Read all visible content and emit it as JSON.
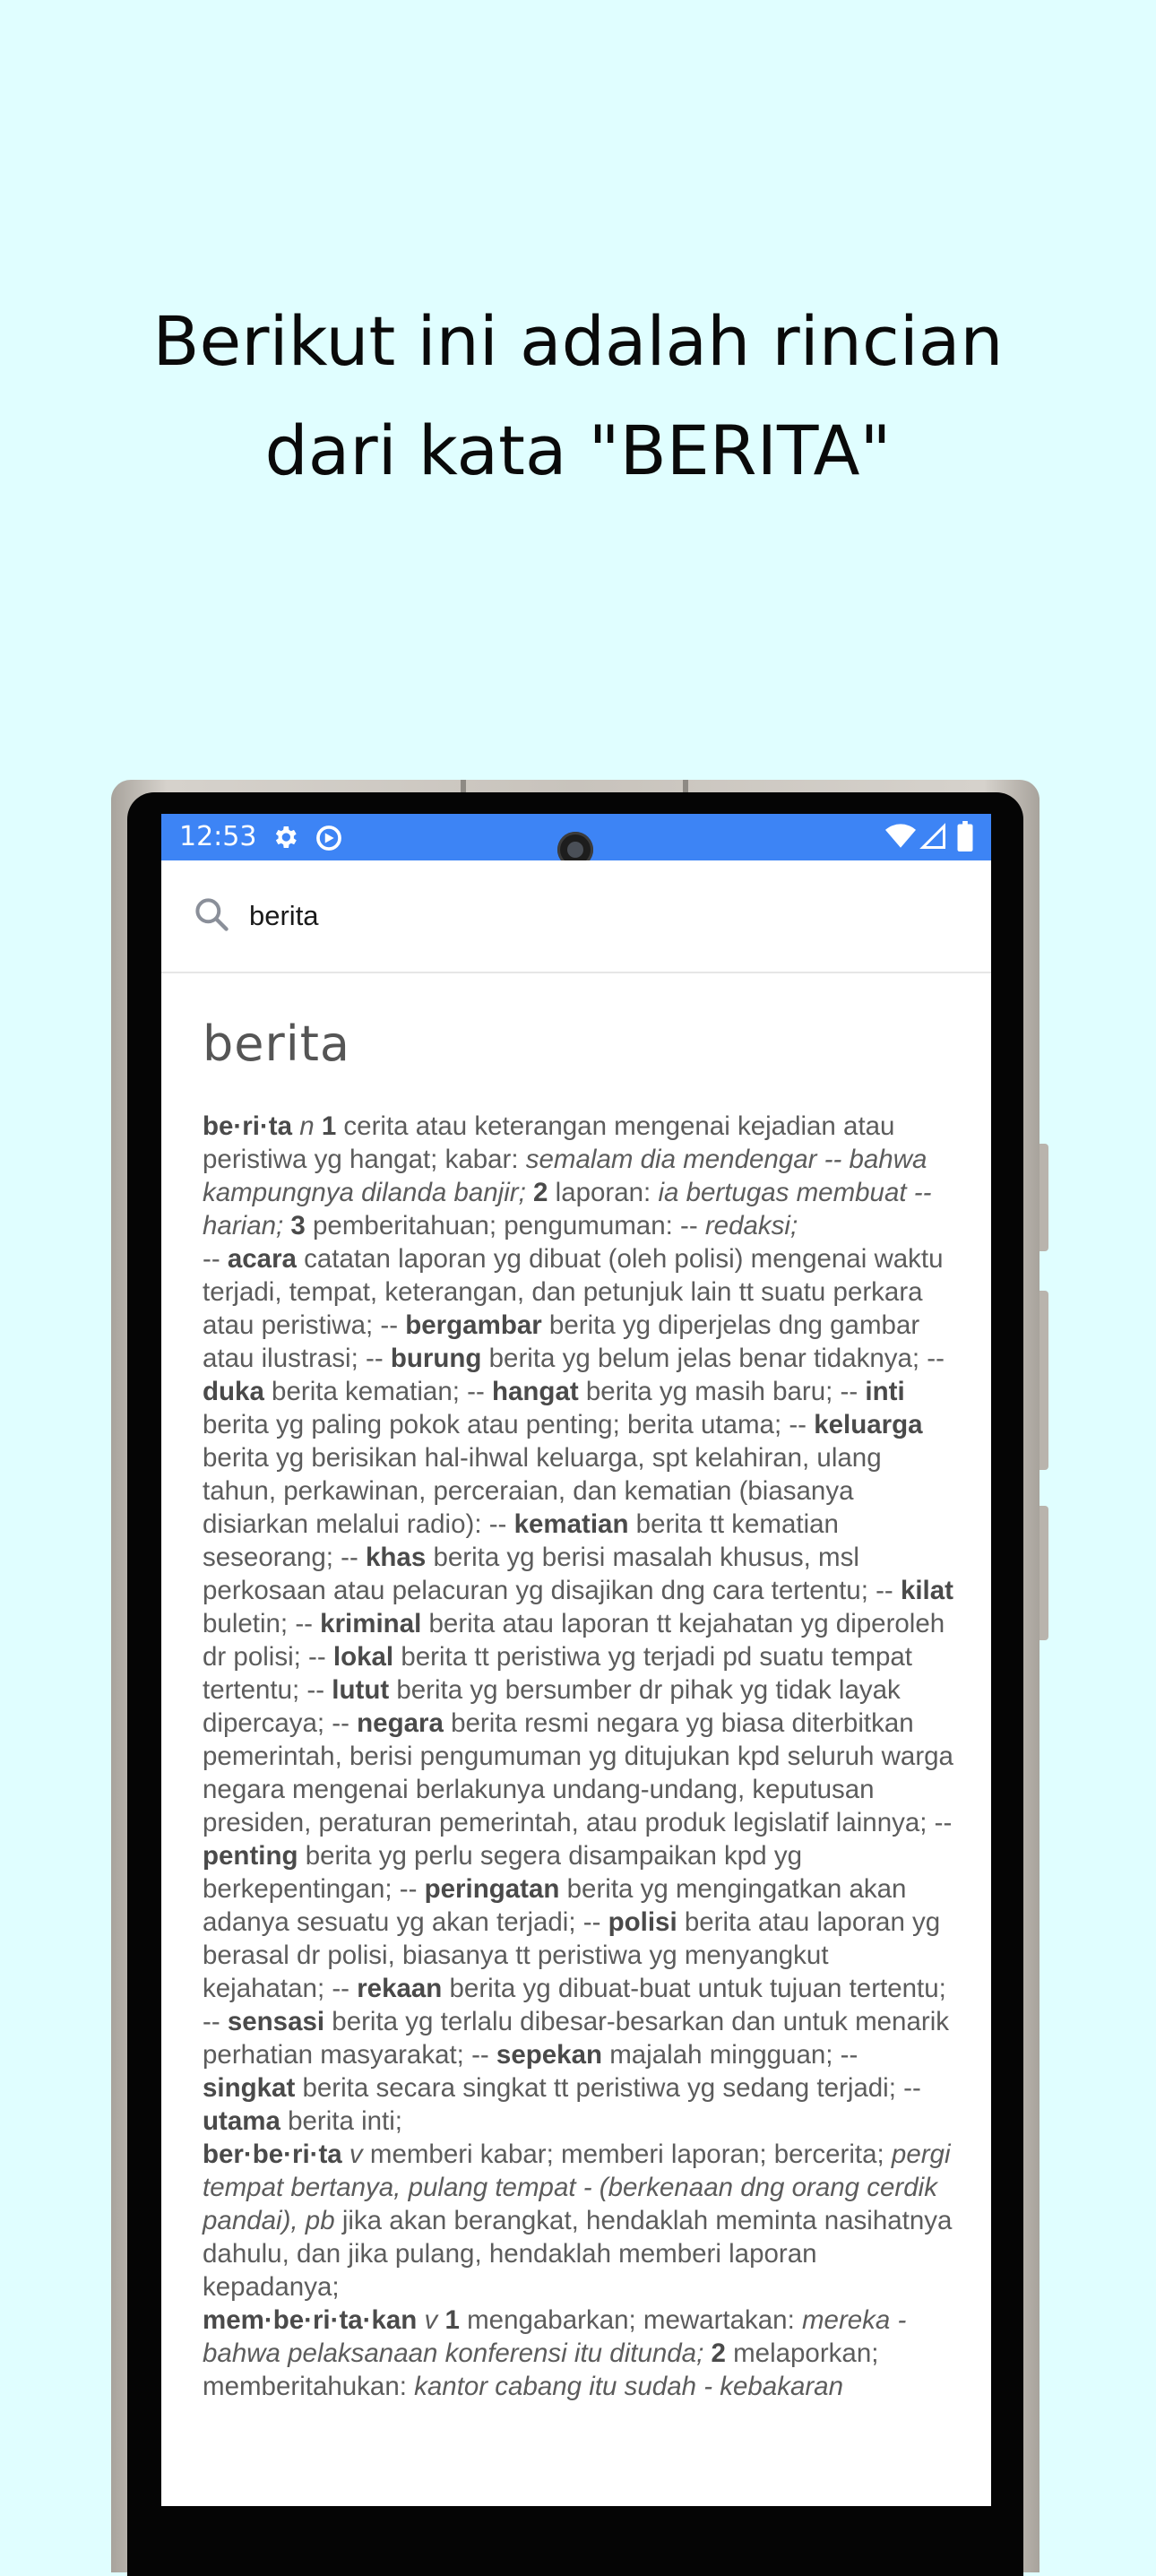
{
  "headline": {
    "line1": "Berikut ini adalah rincian",
    "line2": "dari kata \"BERITA\""
  },
  "status_bar": {
    "time": "12:53",
    "icons": [
      "gear-icon",
      "data-saver-icon",
      "wifi-icon",
      "cell-signal-icon",
      "battery-icon"
    ],
    "color": "#3d84f5"
  },
  "search": {
    "value": "berita",
    "icon": "search-icon"
  },
  "entry": {
    "word": "berita",
    "paragraphs": [
      [
        {
          "t": "be·ri·ta",
          "s": "b"
        },
        {
          "t": " "
        },
        {
          "t": "n",
          "s": "i"
        },
        {
          "t": " "
        },
        {
          "t": "1",
          "s": "b"
        },
        {
          "t": " cerita atau keterangan mengenai kejadian atau peristiwa yg hangat; kabar: "
        },
        {
          "t": "semalam dia mendengar -- bahwa kampungnya dilanda banjir;",
          "s": "i"
        },
        {
          "t": " "
        },
        {
          "t": "2",
          "s": "b"
        },
        {
          "t": " laporan: "
        },
        {
          "t": "ia bertugas membuat -- harian;",
          "s": "i"
        },
        {
          "t": " "
        },
        {
          "t": "3",
          "s": "b"
        },
        {
          "t": " pemberitahuan; pengumuman: -- "
        },
        {
          "t": "redaksi;",
          "s": "i"
        }
      ],
      [
        {
          "t": "-- "
        },
        {
          "t": "acara",
          "s": "b"
        },
        {
          "t": " catatan laporan yg dibuat (oleh polisi) mengenai waktu terjadi, tempat, keterangan, dan petunjuk lain tt suatu perkara atau peristiwa; -- "
        },
        {
          "t": "bergambar",
          "s": "b"
        },
        {
          "t": " berita yg diperjelas dng gambar atau ilustrasi; -- "
        },
        {
          "t": "burung",
          "s": "b"
        },
        {
          "t": " berita yg belum jelas benar tidaknya; -- "
        },
        {
          "t": "duka",
          "s": "b"
        },
        {
          "t": " berita kematian; -- "
        },
        {
          "t": "hangat",
          "s": "b"
        },
        {
          "t": " berita yg masih baru; -- "
        },
        {
          "t": "inti",
          "s": "b"
        },
        {
          "t": " berita yg paling pokok atau penting; berita utama; -- "
        },
        {
          "t": "keluarga",
          "s": "b"
        },
        {
          "t": " berita yg berisikan hal-ihwal keluarga, spt kelahiran, ulang tahun, perkawinan, perceraian, dan kematian (biasanya disiarkan melalui radio): -- "
        },
        {
          "t": "kematian",
          "s": "b"
        },
        {
          "t": " berita tt kematian seseorang; -- "
        },
        {
          "t": "khas",
          "s": "b"
        },
        {
          "t": " berita yg berisi masalah khusus, msl perkosaan atau pelacuran yg disajikan dng cara tertentu; -- "
        },
        {
          "t": "kilat",
          "s": "b"
        },
        {
          "t": " buletin; -- "
        },
        {
          "t": "kriminal",
          "s": "b"
        },
        {
          "t": " berita atau laporan tt kejahatan yg diperoleh dr polisi; -- "
        },
        {
          "t": "lokal",
          "s": "b"
        },
        {
          "t": " berita tt peristiwa yg terjadi pd suatu tempat tertentu; -- "
        },
        {
          "t": "lutut",
          "s": "b"
        },
        {
          "t": " berita yg bersumber dr pihak yg tidak layak dipercaya; -- "
        },
        {
          "t": "negara",
          "s": "b"
        },
        {
          "t": " berita resmi negara yg biasa diterbitkan pemerintah, berisi pengumuman yg ditujukan kpd seluruh warga negara mengenai berlakunya undang-undang, keputusan presiden, peraturan pemerintah, atau produk legislatif lainnya; -- "
        },
        {
          "t": "penting",
          "s": "b"
        },
        {
          "t": " berita yg perlu segera disampaikan kpd yg berkepentingan; -- "
        },
        {
          "t": "peringatan",
          "s": "b"
        },
        {
          "t": " berita yg mengingatkan akan adanya sesuatu yg akan terjadi; -- "
        },
        {
          "t": "polisi",
          "s": "b"
        },
        {
          "t": " berita atau laporan yg berasal dr polisi, biasanya tt peristiwa yg menyangkut kejahatan; -- "
        },
        {
          "t": "rekaan",
          "s": "b"
        },
        {
          "t": " berita yg dibuat-buat untuk tujuan tertentu; -- "
        },
        {
          "t": "sensasi",
          "s": "b"
        },
        {
          "t": " berita yg terlalu dibesar-besarkan dan untuk menarik perhatian masyarakat; -- "
        },
        {
          "t": "sepekan",
          "s": "b"
        },
        {
          "t": " majalah mingguan; -- "
        },
        {
          "t": "singkat",
          "s": "b"
        },
        {
          "t": " berita secara singkat tt peristiwa yg sedang terjadi; -- "
        },
        {
          "t": "utama",
          "s": "b"
        },
        {
          "t": " berita inti;"
        }
      ],
      [
        {
          "t": "ber·be·ri·ta",
          "s": "b"
        },
        {
          "t": " "
        },
        {
          "t": "v",
          "s": "i"
        },
        {
          "t": " memberi kabar; memberi laporan; bercerita; "
        },
        {
          "t": "pergi tempat bertanya, pulang tempat - (berkenaan dng orang cerdik pandai), pb",
          "s": "i"
        },
        {
          "t": " jika akan berangkat, hendaklah meminta nasihatnya dahulu, dan jika pulang, hendaklah memberi laporan kepadanya;"
        }
      ],
      [
        {
          "t": "mem·be·ri·ta·kan",
          "s": "b"
        },
        {
          "t": " "
        },
        {
          "t": "v",
          "s": "i"
        },
        {
          "t": " "
        },
        {
          "t": "1",
          "s": "b"
        },
        {
          "t": " mengabarkan; mewartakan: "
        },
        {
          "t": "mereka - bahwa pelaksanaan konferensi itu ditunda;",
          "s": "i"
        },
        {
          "t": " "
        },
        {
          "t": "2",
          "s": "b"
        },
        {
          "t": " melaporkan; memberitahukan: "
        },
        {
          "t": "kantor cabang itu sudah - kebakaran",
          "s": "i"
        }
      ]
    ]
  }
}
